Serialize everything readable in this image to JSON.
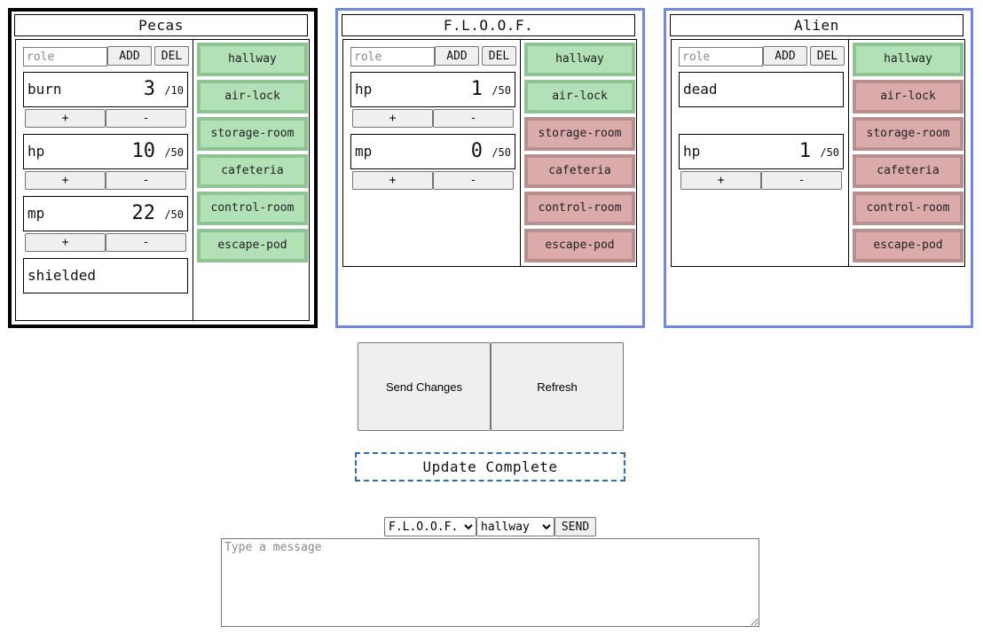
{
  "characters": [
    {
      "name": "Pecas",
      "role_placeholder": "role",
      "add_label": "ADD",
      "del_label": "DEL",
      "plus_label": "+",
      "minus_label": "-",
      "stats": [
        {
          "name": "burn",
          "value": "3",
          "max": "/10"
        },
        {
          "name": "hp",
          "value": "10",
          "max": "/50"
        },
        {
          "name": "mp",
          "value": "22",
          "max": "/50"
        }
      ],
      "tags": [
        "shielded"
      ],
      "rooms": [
        {
          "name": "hallway",
          "status": "open"
        },
        {
          "name": "air-lock",
          "status": "open"
        },
        {
          "name": "storage-room",
          "status": "open"
        },
        {
          "name": "cafeteria",
          "status": "open"
        },
        {
          "name": "control-room",
          "status": "open"
        },
        {
          "name": "escape-pod",
          "status": "open"
        }
      ]
    },
    {
      "name": "F.L.O.O.F.",
      "role_placeholder": "role",
      "add_label": "ADD",
      "del_label": "DEL",
      "plus_label": "+",
      "minus_label": "-",
      "stats": [
        {
          "name": "hp",
          "value": "1",
          "max": "/50"
        },
        {
          "name": "mp",
          "value": "0",
          "max": "/50"
        }
      ],
      "tags": [],
      "rooms": [
        {
          "name": "hallway",
          "status": "open"
        },
        {
          "name": "air-lock",
          "status": "open"
        },
        {
          "name": "storage-room",
          "status": "closed"
        },
        {
          "name": "cafeteria",
          "status": "closed"
        },
        {
          "name": "control-room",
          "status": "closed"
        },
        {
          "name": "escape-pod",
          "status": "closed"
        }
      ]
    },
    {
      "name": "Alien",
      "role_placeholder": "role",
      "add_label": "ADD",
      "del_label": "DEL",
      "plus_label": "+",
      "minus_label": "-",
      "tags_first": true,
      "stats": [
        {
          "name": "hp",
          "value": "1",
          "max": "/50"
        }
      ],
      "tags": [
        "dead"
      ],
      "rooms": [
        {
          "name": "hallway",
          "status": "open"
        },
        {
          "name": "air-lock",
          "status": "closed"
        },
        {
          "name": "storage-room",
          "status": "closed"
        },
        {
          "name": "cafeteria",
          "status": "closed"
        },
        {
          "name": "control-room",
          "status": "closed"
        },
        {
          "name": "escape-pod",
          "status": "closed"
        }
      ]
    }
  ],
  "colors": {
    "open_room": "#b1e1b5",
    "closed_room": "#dbaaaa",
    "selected_border": "#000000",
    "card_border": "#7189d9",
    "status_border": "#2f6fa9"
  },
  "actions": {
    "send_changes_label": "Send Changes",
    "refresh_label": "Refresh"
  },
  "status_text": "Update Complete",
  "chat": {
    "target_options": [
      "F.L.O.O.F."
    ],
    "target_selected": "F.L.O.O.F.",
    "room_options": [
      "hallway"
    ],
    "room_selected": "hallway",
    "send_label": "SEND",
    "message_placeholder": "Type a message"
  }
}
